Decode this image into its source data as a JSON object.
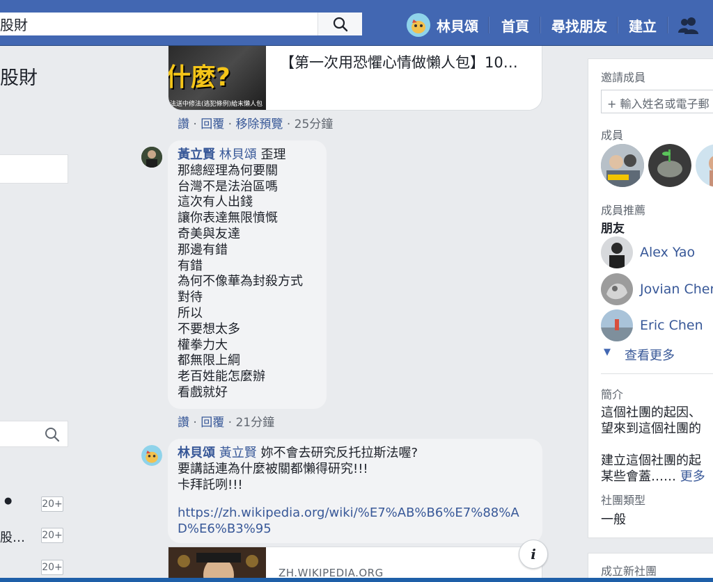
{
  "topbar": {
    "search_value": "股財",
    "user_name": "林貝頌",
    "nav_home": "首頁",
    "nav_find_friends": "尋找朋友",
    "nav_create": "建立"
  },
  "left": {
    "group_title": "股財",
    "rows": [
      {
        "label": "",
        "dot": "●",
        "badge": "20+"
      },
      {
        "label": "股…",
        "dot": "",
        "badge": "20+"
      },
      {
        "label": "",
        "dot": "",
        "badge": "20+"
      }
    ]
  },
  "feed": {
    "preview": {
      "thumb_text": "什麼?",
      "thumb_caption": "法送中修法(逃犯條例)給末懶人包",
      "title": "【第一次用恐懼心情做懶人包】10…",
      "actions": {
        "like": "讚",
        "reply": "回覆",
        "remove": "移除預覽",
        "time": "25分鐘"
      }
    },
    "comment1": {
      "author": "黃立賢",
      "mention": "林貝頌",
      "lines": [
        "歪理",
        "那總經理為何要關",
        "台灣不是法治區嗎",
        "這次有人出錢",
        "讓你表達無限憤慨",
        "奇美與友達",
        "那邊有錯",
        "有錯",
        "為何不像華為封殺方式",
        "對待",
        "所以",
        "不要想太多",
        "權拳力大",
        "都無限上綱",
        "老百姓能怎麼辦",
        "看戲就好"
      ],
      "actions": {
        "like": "讚",
        "reply": "回覆",
        "time": "21分鐘"
      }
    },
    "comment2": {
      "author": "林貝頌",
      "mention": "黃立賢",
      "lines": [
        "妳不會去研究反托拉斯法喔?",
        "要講話連為什麼被關都懶得研究!!!",
        "卡拜託咧!!!"
      ],
      "link": "https://zh.wikipedia.org/wiki/%E7%AB%B6%E7%88%AD%E6%B3%95"
    },
    "link_card": {
      "domain": "ZH.WIKIPEDIA.ORG",
      "info": "i"
    }
  },
  "right": {
    "invite_label": "邀請成員",
    "invite_placeholder": "+ 輸入姓名或電子郵",
    "members_label": "成員",
    "suggest_label": "成員推薦",
    "friends_label": "朋友",
    "friends": [
      "Alex Yao",
      "Jovian Chen",
      "Eric Chen"
    ],
    "see_more": "查看更多",
    "about_label": "簡介",
    "about_lines": [
      "這個社團的起因、",
      "望來到這個社團的"
    ],
    "about_more_line": "建立這個社團的起",
    "about_more_line2": "某些會蓋……",
    "more": "更多",
    "type_label": "社團類型",
    "type_value": "一般",
    "new_group": "成立新社團"
  }
}
